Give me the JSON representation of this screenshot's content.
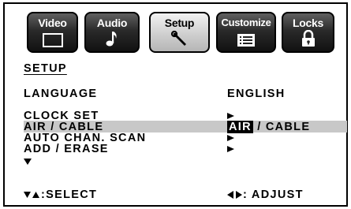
{
  "tabs": [
    {
      "label": "Video",
      "icon": "screen-icon",
      "active": false
    },
    {
      "label": "Audio",
      "icon": "music-note-icon",
      "active": false
    },
    {
      "label": "Setup",
      "icon": "wrench-icon",
      "active": true
    },
    {
      "label": "Customize",
      "icon": "list-icon",
      "active": false
    },
    {
      "label": "Locks",
      "icon": "padlock-icon",
      "active": false
    }
  ],
  "section_title": "SETUP",
  "menu": {
    "language_label": "LANGUAGE",
    "language_value": "ENGLISH",
    "clock_set_label": "CLOCK SET",
    "air_cable_label": "AIR / CABLE",
    "air_cable_selected": "AIR",
    "air_cable_rest": " / CABLE",
    "auto_scan_label": "AUTO CHAN. SCAN",
    "add_erase_label": "ADD / ERASE"
  },
  "footer": {
    "select_hint": ":SELECT",
    "adjust_hint": ": ADJUST"
  },
  "colors": {
    "highlight": "#c8c8c8",
    "tab_dark": "#1a1a1a",
    "tab_active": "#d0d0d0"
  }
}
